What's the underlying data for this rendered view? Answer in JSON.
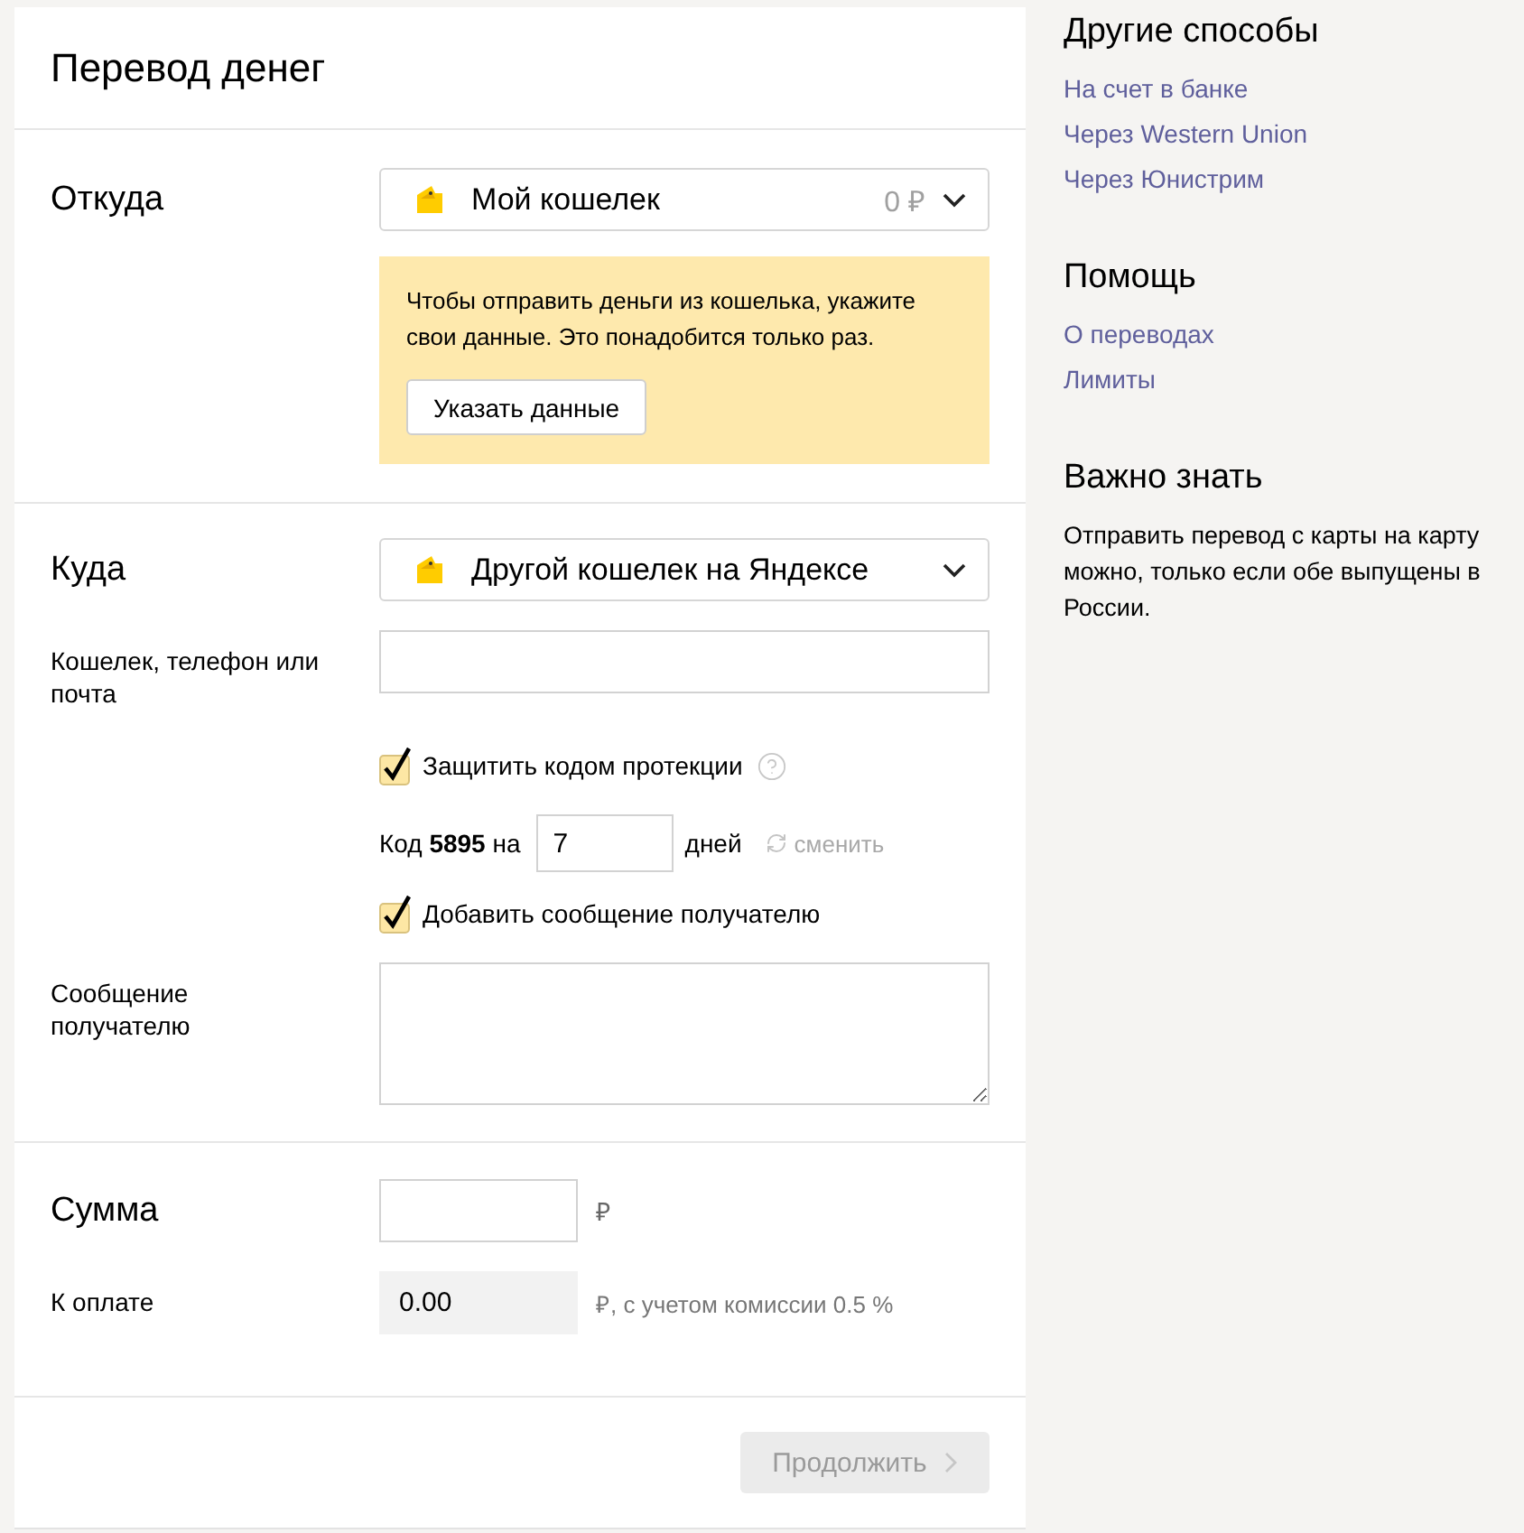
{
  "title": "Перевод денег",
  "from": {
    "label": "Откуда",
    "wallet": {
      "name": "Мой кошелек",
      "balance": "0 ₽"
    },
    "notice": {
      "text": "Чтобы отправить деньги из кошелька, укажите свои данные. Это понадобится только раз.",
      "button": "Указать данные"
    }
  },
  "to": {
    "label": "Куда",
    "wallet": {
      "name": "Другой кошелек на Яндексе"
    },
    "recipient": {
      "label": "Кошелек, телефон или почта"
    },
    "protect": {
      "label": "Защитить кодом протекции",
      "checked": true
    },
    "code": {
      "text": "Код **5895** на",
      "days": "7",
      "unit": "дней",
      "change": "сменить"
    },
    "add_message": {
      "label": "Добавить сообщение получателю",
      "checked": true
    },
    "message": {
      "label": "Сообщение получателю"
    }
  },
  "amount": {
    "label": "Сумма",
    "currency": "₽"
  },
  "payable": {
    "label": "К оплате",
    "value": "0.00",
    "note": "₽, с учетом комиссии 0.5 %"
  },
  "submit": {
    "label": "Продолжить",
    "disabled": true
  },
  "sidebar": [
    {
      "kind": "links",
      "title": "Другие способы",
      "links": [
        "На счет в банке",
        "Через Western Union",
        "Через Юнистрим"
      ]
    },
    {
      "kind": "links",
      "title": "Помощь",
      "links": [
        "О переводах",
        "Лимиты"
      ]
    },
    {
      "kind": "text",
      "title": "Важно знать",
      "text": "Отправить перевод с карты на карту можно, только если обе выпущены в России."
    }
  ]
}
